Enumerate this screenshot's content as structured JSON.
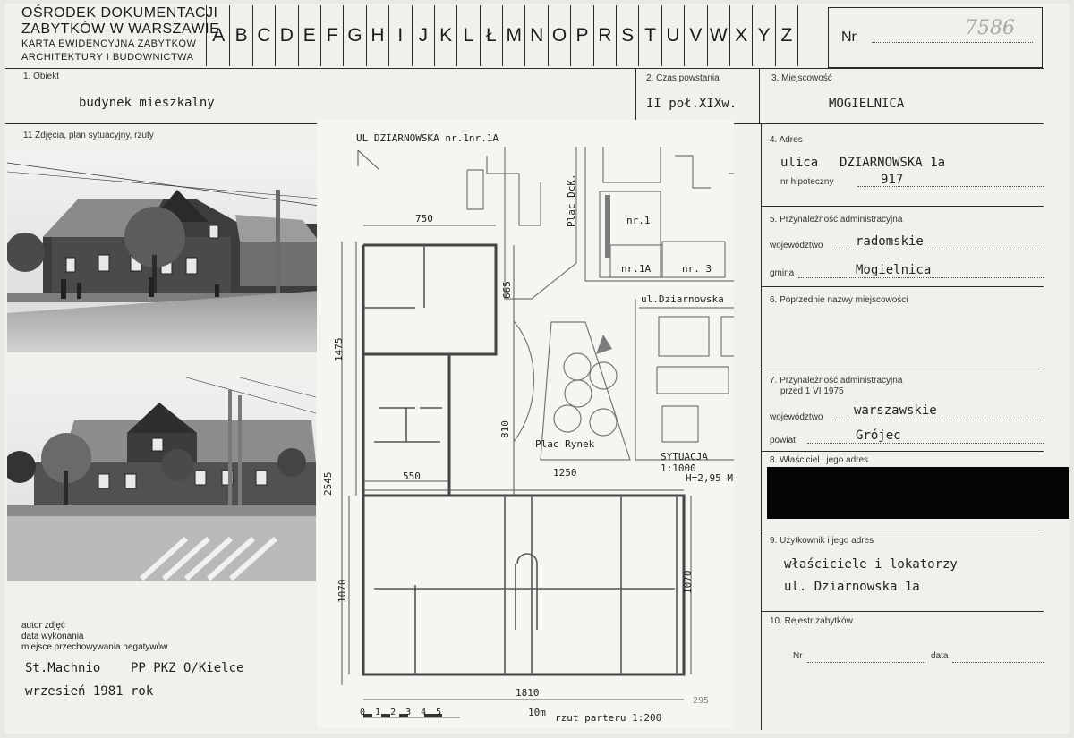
{
  "institution": {
    "line1": "OŚRODEK DOKUMENTACJI",
    "line2": "ZABYTKÓW W WARSZAWIE",
    "line3": "KARTA EWIDENCYJNA ZABYTKÓW",
    "line4": "ARCHITEKTURY I BUDOWNICTWA"
  },
  "alphabet": [
    "A",
    "B",
    "C",
    "D",
    "E",
    "F",
    "G",
    "H",
    "I",
    "J",
    "K",
    "L",
    "Ł",
    "M",
    "N",
    "O",
    "P",
    "R",
    "S",
    "T",
    "U",
    "V",
    "W",
    "X",
    "Y",
    "Z"
  ],
  "nr": {
    "label": "Nr",
    "value": "7586"
  },
  "fields": {
    "obiekt": {
      "label": "1. Obiekt",
      "value": "budynek mieszkalny"
    },
    "czas": {
      "label": "2. Czas powstania",
      "value": "II poł.XIXw."
    },
    "miejscowosc": {
      "label": "3. Miejscowość",
      "value": "MOGIELNICA"
    },
    "adres": {
      "label": "4. Adres",
      "ulica_prefix": "ulica",
      "ulica": "DZIARNOWSKA 1a",
      "hipoteczny_label": "nr hipoteczny",
      "hipoteczny": "917"
    },
    "przynaleznosc": {
      "label": "5. Przynależność administracyjna",
      "woj_label": "województwo",
      "woj": "radomskie",
      "gmina_label": "gmina",
      "gmina": "Mogielnica"
    },
    "poprzednie": {
      "label": "6. Poprzednie nazwy miejscowości"
    },
    "przynaleznosc_1975": {
      "label": "7. Przynależność administracyjna",
      "label2": "przed 1 VI 1975",
      "woj_label": "województwo",
      "woj": "warszawskie",
      "powiat_label": "powiat",
      "powiat": "Grójec"
    },
    "wlasciciel": {
      "label": "8. Właściciel i jego adres"
    },
    "uzytkownik": {
      "label": "9. Użytkownik i jego adres",
      "line1": "właściciele i lokatorzy",
      "line2": "ul. Dziarnowska 1a"
    },
    "rejestr": {
      "label": "10. Rejestr zabytków",
      "nr_label": "Nr",
      "data_label": "data"
    },
    "zdjecia": {
      "label": "11 Zdjęcia, plan sytuacyjny, rzuty"
    }
  },
  "photo_meta": {
    "label1": "autor zdjęć",
    "label2": "data wykonania",
    "label3": "miejsce przechowywania negatywów",
    "author": "St.Machnio",
    "storage": "PP PKZ O/Kielce",
    "date": "wrzesień 1981 rok"
  },
  "plan": {
    "street_top": "UL DZIARNOWSKA nr.1nr.1A",
    "plac_dck": "Plac DcK.",
    "nr1": "nr.1",
    "nr1a": "nr.1A",
    "nr3": "nr. 3",
    "ul_dziarnowska": "ul.Dziarnowska",
    "plac_rynek": "Plac Rynek",
    "sytuacja": "SYTUACJA 1:1000",
    "height": "H=2,95 M",
    "rzut": "rzut parteru 1:200",
    "scale_ticks": [
      "0",
      "1",
      "2",
      "3",
      "4",
      "5"
    ],
    "scale_end": "10m",
    "dims": {
      "d750": "750",
      "d665": "665",
      "d1475": "1475",
      "d2545": "2545",
      "d810": "810",
      "d550": "550",
      "d1250": "1250",
      "d1070a": "1070",
      "d1070b": "1070",
      "d1810": "1810",
      "d295": "295"
    }
  }
}
